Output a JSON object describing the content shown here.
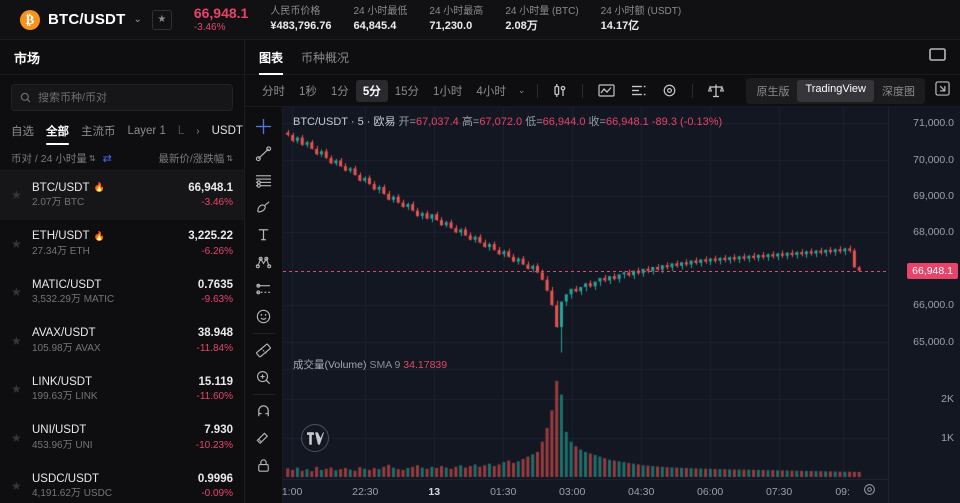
{
  "header": {
    "coin_icon": "bitcoin-icon",
    "pair": "BTC/USDT",
    "chevron": "⌄",
    "star": "★",
    "last_price": "66,948.1",
    "change_pct": "-3.46%",
    "stats": [
      {
        "label": "人民币价格",
        "value": "¥483,796.76"
      },
      {
        "label": "24 小时最低",
        "value": "64,845.4"
      },
      {
        "label": "24 小时最高",
        "value": "71,230.0"
      },
      {
        "label": "24 小时量 (BTC)",
        "value": "2.08万"
      },
      {
        "label": "24 小时额 (USDT)",
        "value": "14.17亿"
      }
    ]
  },
  "sidebar": {
    "title": "市场",
    "search_placeholder": "搜索币种/币对",
    "search_value": "",
    "categories": [
      {
        "label": "自选",
        "active": false,
        "dim": false
      },
      {
        "label": "全部",
        "active": true,
        "dim": false
      },
      {
        "label": "主流币",
        "active": false,
        "dim": false
      },
      {
        "label": "Layer 1",
        "active": false,
        "dim": false
      },
      {
        "label": "L",
        "active": false,
        "dim": true
      }
    ],
    "cat_arrow": "›",
    "quote": "USDT",
    "quote_chevron": "⌄",
    "col_left": "币对 / 24 小时量",
    "col_right": "最新价/涨跌幅",
    "sort_icon": "⇅",
    "swap_icon": "⇄",
    "rows": [
      {
        "symbol": "BTC/USDT",
        "hot": true,
        "volume": "2.07万 BTC",
        "price": "66,948.1",
        "change": "-3.46%",
        "selected": true
      },
      {
        "symbol": "ETH/USDT",
        "hot": true,
        "volume": "27.34万 ETH",
        "price": "3,225.22",
        "change": "-6.26%",
        "selected": false
      },
      {
        "symbol": "MATIC/USDT",
        "hot": false,
        "volume": "3,532.29万 MATIC",
        "price": "0.7635",
        "change": "-9.63%",
        "selected": false
      },
      {
        "symbol": "AVAX/USDT",
        "hot": false,
        "volume": "105.98万 AVAX",
        "price": "38.948",
        "change": "-11.84%",
        "selected": false
      },
      {
        "symbol": "LINK/USDT",
        "hot": false,
        "volume": "199.63万 LINK",
        "price": "15.119",
        "change": "-11.60%",
        "selected": false
      },
      {
        "symbol": "UNI/USDT",
        "hot": false,
        "volume": "453.96万 UNI",
        "price": "7.930",
        "change": "-10.23%",
        "selected": false
      },
      {
        "symbol": "USDC/USDT",
        "hot": false,
        "volume": "4,191.62万 USDC",
        "price": "0.9996",
        "change": "-0.09%",
        "selected": false
      }
    ]
  },
  "main": {
    "tabs": [
      {
        "label": "图表",
        "active": true
      },
      {
        "label": "币种概况",
        "active": false
      }
    ],
    "window_icon": "window-icon",
    "intervals": [
      {
        "label": "分时",
        "active": false
      },
      {
        "label": "1秒",
        "active": false
      },
      {
        "label": "1分",
        "active": false
      },
      {
        "label": "5分",
        "active": true
      },
      {
        "label": "15分",
        "active": false
      },
      {
        "label": "1小时",
        "active": false
      },
      {
        "label": "4小时",
        "active": false
      }
    ],
    "interval_chevron": "⌄",
    "toolbar_icons": [
      "candlestick-type-icon",
      "indicator-icon",
      "list-icon",
      "gear-icon",
      "compare-icon"
    ],
    "view_modes": [
      {
        "label": "原生版",
        "on": false
      },
      {
        "label": "TradingView",
        "on": true
      },
      {
        "label": "深度图",
        "on": false
      }
    ],
    "expand_icon": "expand-icon"
  },
  "chart_data": {
    "type": "candlestick",
    "title": "BTC/USDT · 5 · 欧易",
    "symbol": "BTC/USDT",
    "interval": "5",
    "exchange": "欧易",
    "legend": {
      "open_label": "开=",
      "open": "67,037.4",
      "high_label": "高=",
      "high": "67,072.0",
      "low_label": "低=",
      "low": "66,944.0",
      "close_label": "收=",
      "close": "66,948.1",
      "change": "-89.3 (-0.13%)"
    },
    "price_axis": {
      "ticks": [
        "71,000.0",
        "70,000.0",
        "69,000.0",
        "68,000.0",
        "66,000.0",
        "65,000.0"
      ],
      "tick_values": [
        71000,
        70000,
        69000,
        68000,
        66000,
        65000
      ],
      "ylim": [
        64300,
        71450
      ],
      "current_price": "66,948.1",
      "current_value": 66948.1
    },
    "volume_axis": {
      "ticks": [
        "2K",
        "1K"
      ],
      "tick_values": [
        2000,
        1000
      ],
      "ylim": [
        0,
        2600
      ]
    },
    "time_axis": {
      "labels": [
        "1:00",
        "22:30",
        "13",
        "01:30",
        "03:00",
        "04:30",
        "06:00",
        "07:30",
        "09:"
      ],
      "bold_index": 2,
      "positions_pct": [
        1.5,
        13.6,
        25.0,
        36.4,
        47.8,
        59.2,
        70.6,
        82.0,
        92.5
      ]
    },
    "volume_panel": {
      "label": "成交量(Volume)",
      "sma_label": "SMA 9",
      "sma_value": "34.17839"
    },
    "colors": {
      "up": "#26a69a",
      "down": "#ef5350",
      "background": "#131722",
      "grid": "#1c2030",
      "accent": "#e8436a"
    },
    "series": {
      "note": "OHLC candles, 5-minute bars; downtrend from ~70,800 to ~66,000 then sideways recovery to ~66,950",
      "open": [
        70750,
        70680,
        70520,
        70610,
        70410,
        70480,
        70300,
        70150,
        70230,
        70050,
        69900,
        69980,
        69820,
        69700,
        69760,
        69580,
        69420,
        69500,
        69330,
        69180,
        69250,
        69060,
        68900,
        68980,
        68820,
        68700,
        68780,
        68600,
        68450,
        68530,
        68380,
        68500,
        68340,
        68200,
        68280,
        68120,
        68000,
        68080,
        67920,
        67800,
        67880,
        67720,
        67600,
        67680,
        67520,
        67400,
        67480,
        67330,
        67200,
        67280,
        67120,
        67000,
        67080,
        66900,
        66700,
        66400,
        66000,
        65400,
        66100,
        66300,
        66450,
        66380,
        66500,
        66600,
        66520,
        66650,
        66750,
        66680,
        66800,
        66720,
        66850,
        66900,
        66820,
        66950,
        66880,
        67000,
        66940,
        67050,
        66980,
        67100,
        67040,
        67150,
        67080,
        67180,
        67120,
        67230,
        67160,
        67260,
        67200,
        67280,
        67220,
        67300,
        67240,
        67320,
        67260,
        67340,
        67280,
        67360,
        67300,
        67380,
        67320,
        67400,
        67340,
        67420,
        67360,
        67440,
        67380,
        67460,
        67400,
        67480,
        67420,
        67500,
        67440,
        67520,
        67460,
        67540,
        67480,
        67560,
        67500,
        67037
      ],
      "high": [
        70820,
        70740,
        70640,
        70680,
        70520,
        70540,
        70380,
        70280,
        70300,
        70120,
        70020,
        70050,
        69900,
        69800,
        69830,
        69650,
        69540,
        69570,
        69410,
        69300,
        69320,
        69140,
        69020,
        69050,
        68900,
        68820,
        68850,
        68680,
        68570,
        68600,
        68500,
        68570,
        68420,
        68320,
        68350,
        68200,
        68120,
        68150,
        68000,
        67920,
        67950,
        67800,
        67720,
        67750,
        67600,
        67520,
        67550,
        67410,
        67320,
        67350,
        67200,
        67120,
        67150,
        66980,
        66800,
        66500,
        66120,
        65500,
        66250,
        66420,
        66530,
        66480,
        66600,
        66680,
        66620,
        66730,
        66830,
        66780,
        66880,
        66820,
        66930,
        66980,
        66920,
        67030,
        66980,
        67080,
        67040,
        67130,
        67080,
        67180,
        67140,
        67230,
        67180,
        67260,
        67220,
        67310,
        67260,
        67340,
        67300,
        67360,
        67320,
        67380,
        67340,
        67400,
        67360,
        67420,
        67380,
        67440,
        67400,
        67460,
        67420,
        67480,
        67440,
        67500,
        67460,
        67520,
        67480,
        67540,
        67500,
        67560,
        67520,
        67580,
        67540,
        67600,
        67560,
        67620,
        67580,
        67640,
        67560,
        67072
      ],
      "low": [
        70640,
        70480,
        70450,
        70380,
        70340,
        70280,
        70120,
        70080,
        70020,
        69880,
        69840,
        69800,
        69680,
        69640,
        69560,
        69400,
        69360,
        69310,
        69160,
        69080,
        69040,
        68880,
        68820,
        68800,
        68680,
        68620,
        68580,
        68430,
        68360,
        68360,
        68280,
        68320,
        68180,
        68140,
        68100,
        67980,
        67900,
        67900,
        67780,
        67720,
        67700,
        67580,
        67500,
        67500,
        67380,
        67320,
        67310,
        67180,
        67120,
        67100,
        66980,
        66900,
        66880,
        66680,
        66380,
        65980,
        65380,
        64700,
        65980,
        66180,
        66350,
        66280,
        66380,
        66480,
        66420,
        66530,
        66630,
        66580,
        66680,
        66620,
        66730,
        66780,
        66720,
        66830,
        66780,
        66880,
        66840,
        66930,
        66880,
        66980,
        66940,
        67030,
        66980,
        67060,
        67020,
        67110,
        67060,
        67140,
        67100,
        67160,
        67120,
        67180,
        67140,
        67200,
        67160,
        67220,
        67180,
        67240,
        67200,
        67260,
        67220,
        67280,
        67240,
        67300,
        67260,
        67320,
        67280,
        67340,
        67300,
        67360,
        67320,
        67380,
        67340,
        67400,
        67360,
        67420,
        67380,
        67440,
        67360,
        66944
      ],
      "close": [
        70680,
        70520,
        70610,
        70410,
        70480,
        70300,
        70150,
        70230,
        70050,
        69900,
        69980,
        69820,
        69700,
        69760,
        69580,
        69420,
        69500,
        69330,
        69180,
        69250,
        69060,
        68900,
        68980,
        68820,
        68700,
        68780,
        68600,
        68450,
        68530,
        68380,
        68500,
        68340,
        68200,
        68280,
        68120,
        68000,
        68080,
        67920,
        67800,
        67880,
        67720,
        67600,
        67680,
        67520,
        67400,
        67480,
        67330,
        67200,
        67280,
        67120,
        67000,
        67080,
        66900,
        66700,
        66400,
        66000,
        65400,
        66100,
        66300,
        66450,
        66380,
        66500,
        66600,
        66520,
        66650,
        66750,
        66680,
        66800,
        66720,
        66850,
        66900,
        66820,
        66950,
        66880,
        67000,
        66940,
        67050,
        66980,
        67100,
        67040,
        67150,
        67080,
        67180,
        67120,
        67230,
        67160,
        67260,
        67200,
        67280,
        67220,
        67300,
        67240,
        67320,
        67260,
        67340,
        67280,
        67360,
        67300,
        67380,
        67320,
        67400,
        67340,
        67420,
        67360,
        67440,
        67380,
        67460,
        67400,
        67480,
        67420,
        67500,
        67440,
        67520,
        67460,
        67540,
        67480,
        67560,
        67500,
        67037,
        66948
      ],
      "volume": [
        220,
        180,
        240,
        160,
        200,
        150,
        260,
        180,
        210,
        240,
        170,
        200,
        230,
        190,
        160,
        250,
        210,
        180,
        230,
        200,
        260,
        310,
        240,
        200,
        180,
        230,
        260,
        300,
        240,
        210,
        260,
        230,
        280,
        240,
        210,
        260,
        300,
        240,
        280,
        320,
        260,
        300,
        340,
        280,
        320,
        380,
        420,
        360,
        400,
        460,
        520,
        580,
        640,
        900,
        1250,
        1700,
        2450,
        2100,
        1150,
        900,
        780,
        700,
        640,
        600,
        560,
        520,
        480,
        440,
        420,
        400,
        380,
        360,
        340,
        320,
        300,
        290,
        280,
        270,
        260,
        250,
        245,
        240,
        235,
        230,
        225,
        220,
        215,
        210,
        208,
        205,
        200,
        198,
        195,
        192,
        190,
        188,
        185,
        183,
        180,
        178,
        175,
        173,
        170,
        168,
        165,
        163,
        160,
        158,
        155,
        153,
        150,
        148,
        145,
        143,
        140,
        138,
        135,
        133,
        130,
        128,
        125,
        122
      ]
    }
  }
}
